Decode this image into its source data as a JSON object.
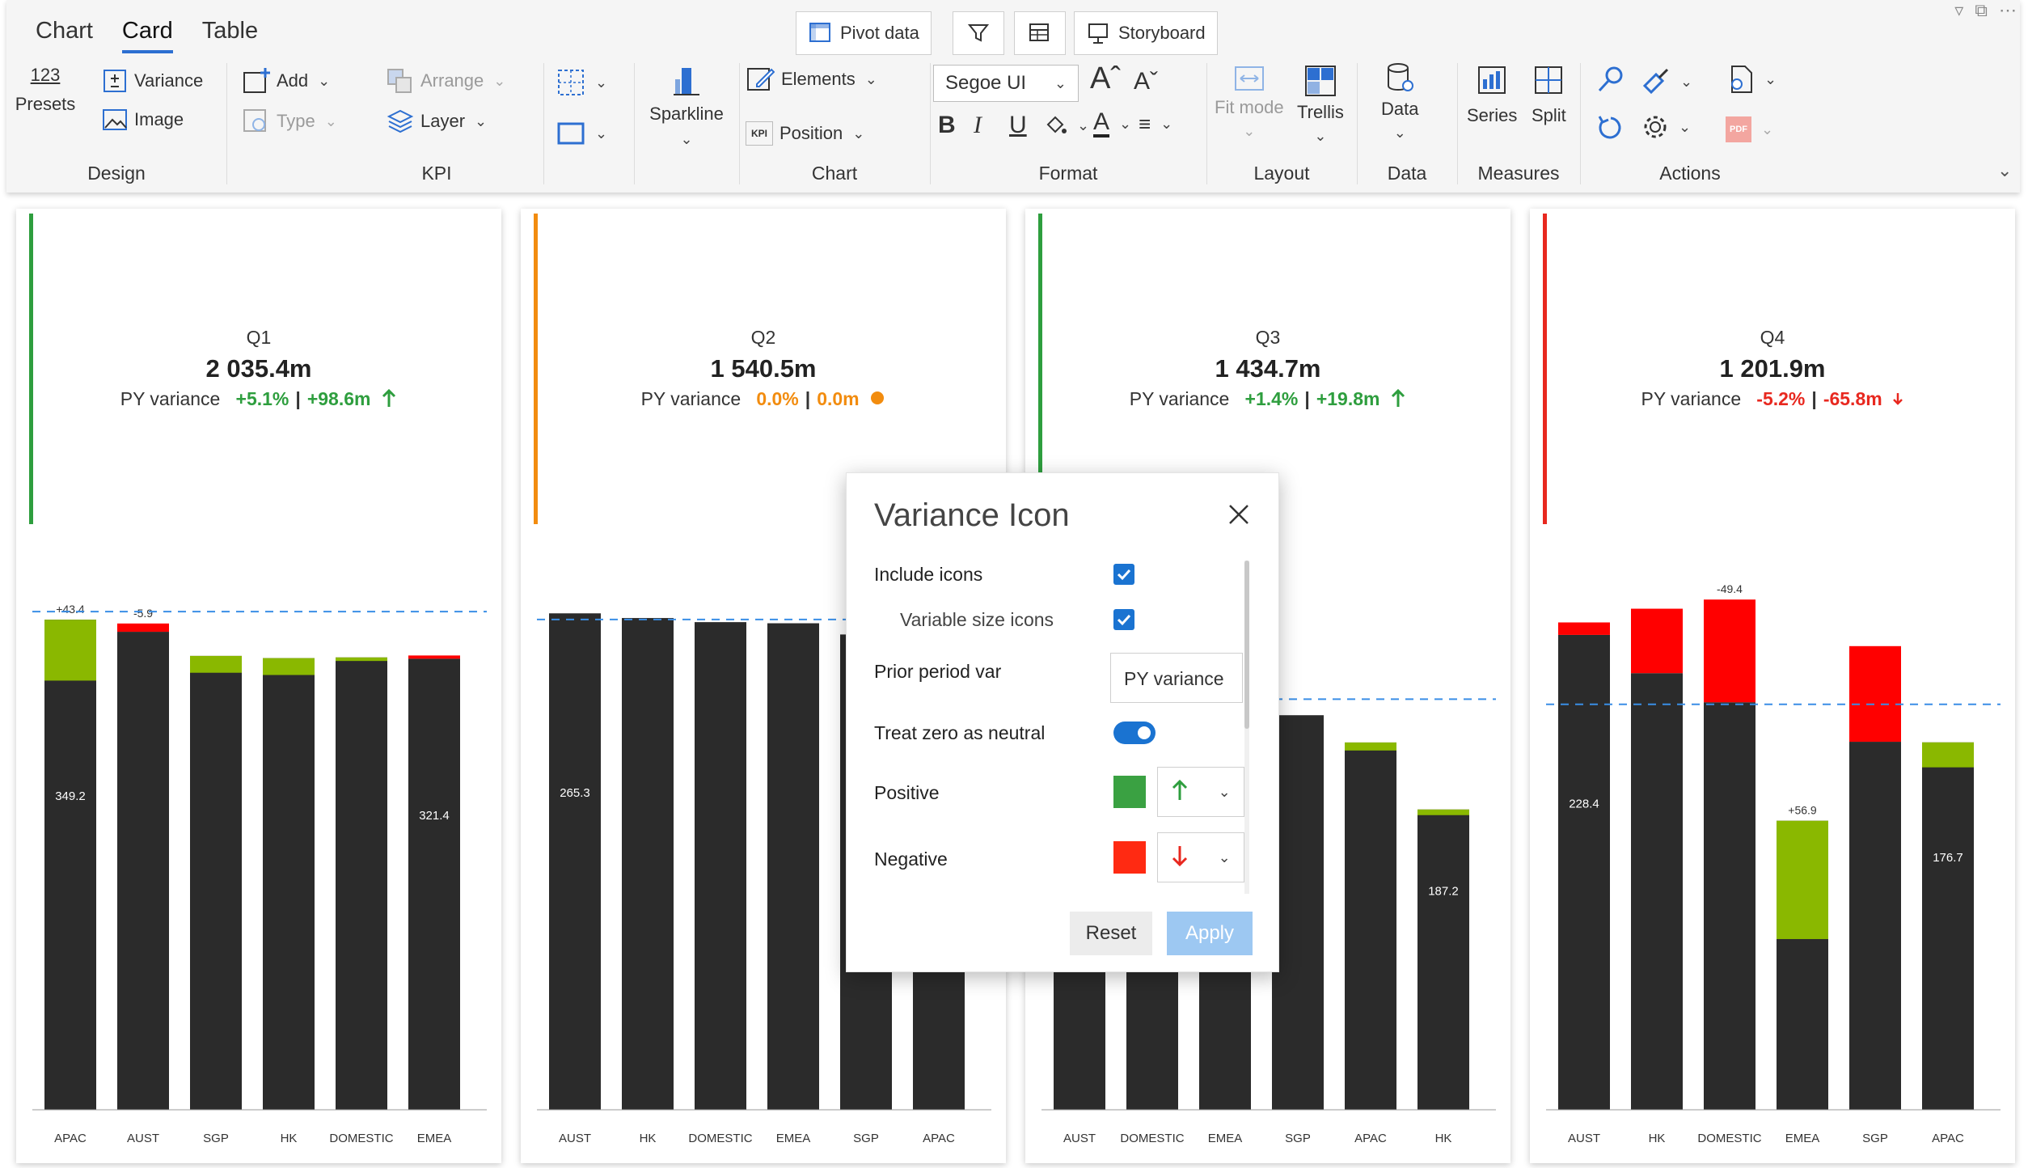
{
  "ribbon": {
    "tabs": [
      "Chart",
      "Card",
      "Table"
    ],
    "active_tab": "Card",
    "top_buttons": {
      "pivot": "Pivot data",
      "storyboard": "Storyboard"
    },
    "design": {
      "label": "Design",
      "presets_num": "123",
      "presets": "Presets",
      "variance": "Variance",
      "image": "Image"
    },
    "kpi": {
      "label": "KPI",
      "add": "Add",
      "type": "Type",
      "arrange": "Arrange",
      "layer": "Layer"
    },
    "sparkline": "Sparkline",
    "chart": {
      "label": "Chart",
      "elements": "Elements",
      "position": "Position",
      "kpi_icon": "KPI"
    },
    "format": {
      "label": "Format",
      "font": "Segoe UI",
      "bold": "B",
      "italic": "I",
      "underline": "U"
    },
    "layout": {
      "label": "Layout",
      "fit_mode": "Fit mode",
      "trellis": "Trellis"
    },
    "data": {
      "label": "Data",
      "data_btn": "Data"
    },
    "measures": {
      "label": "Measures",
      "series": "Series",
      "split": "Split"
    },
    "actions": {
      "label": "Actions",
      "pdf": "PDF"
    }
  },
  "colors": {
    "positive": "#2e9e3e",
    "neutral": "#f28c0f",
    "negative": "#e8281f",
    "bar": "#2b2b2b",
    "pos_bar": "#8ab800",
    "neg_bar": "#ff0000",
    "avg_line": "#3a8ee6"
  },
  "cards": [
    {
      "quarter": "Q1",
      "value": "2 035.4m",
      "var_label": "PY variance",
      "pct": "+5.1%",
      "sep": "|",
      "abs": "+98.6m",
      "status": "positive",
      "icon": "arrow-up-icon"
    },
    {
      "quarter": "Q2",
      "value": "1 540.5m",
      "var_label": "PY variance",
      "pct": "0.0%",
      "sep": "|",
      "abs": "0.0m",
      "status": "neutral",
      "icon": "dot-icon"
    },
    {
      "quarter": "Q3",
      "value": "1 434.7m",
      "var_label": "PY variance",
      "pct": "+1.4%",
      "sep": "|",
      "abs": "+19.8m",
      "status": "positive",
      "icon": "arrow-up-icon"
    },
    {
      "quarter": "Q4",
      "value": "1 201.9m",
      "var_label": "PY variance",
      "pct": "-5.2%",
      "sep": "|",
      "abs": "-65.8m",
      "status": "negative",
      "icon": "arrow-down-small-icon"
    }
  ],
  "chart_data": [
    {
      "type": "bar",
      "title": "Q1",
      "categories": [
        "APAC",
        "AUST",
        "SGP",
        "HK",
        "DOMESTIC",
        "EMEA"
      ],
      "values": [
        349.2,
        340.6,
        323.4,
        321.8,
        322.3,
        321.4
      ],
      "variance": [
        43.4,
        -5.9,
        12.0,
        12.0,
        2.5,
        -2.3
      ],
      "bar_labels": [
        "349.2",
        "",
        "",
        "",
        "",
        "321.4"
      ],
      "var_labels": [
        "+43.4",
        "-5.9",
        "",
        "",
        "",
        ""
      ],
      "ylim": [
        0,
        400
      ],
      "avg": 355
    },
    {
      "type": "bar",
      "title": "Q2",
      "categories": [
        "AUST",
        "HK",
        "DOMESTIC",
        "EMEA",
        "SGP",
        "APAC"
      ],
      "values": [
        265.3,
        262.8,
        260.6,
        260.0,
        254.0,
        250.0
      ],
      "variance": [
        0,
        0,
        0,
        0,
        0,
        0
      ],
      "bar_labels": [
        "265.3",
        "",
        "",
        "",
        "",
        ""
      ],
      "var_labels": [
        "",
        "",
        "",
        "",
        "",
        ""
      ],
      "ylim": [
        0,
        300
      ],
      "avg": 262
    },
    {
      "type": "bar",
      "title": "Q3",
      "categories": [
        "AUST",
        "DOMESTIC",
        "EMEA",
        "SGP",
        "APAC",
        "HK"
      ],
      "values": [
        248.0,
        248.0,
        248.0,
        246.0,
        229.0,
        187.2
      ],
      "variance": [
        0,
        0,
        0,
        0,
        5.0,
        3.5
      ],
      "bar_labels": [
        "",
        "",
        "",
        "",
        "",
        "187.2"
      ],
      "var_labels": [
        "",
        "",
        "",
        "",
        "",
        ""
      ],
      "ylim": [
        0,
        350
      ],
      "avg": 256
    },
    {
      "type": "bar",
      "title": "Q4",
      "categories": [
        "AUST",
        "HK",
        "DOMESTIC",
        "EMEA",
        "SGP",
        "APAC"
      ],
      "values": [
        228.4,
        210.0,
        196.0,
        139.0,
        177.0,
        176.7
      ],
      "variance": [
        -6.0,
        -31.0,
        -49.4,
        56.9,
        -46.0,
        12.0
      ],
      "bar_labels": [
        "228.4",
        "",
        "",
        "",
        "",
        "176.7"
      ],
      "var_labels": [
        "",
        "",
        "-49.4",
        "+56.9",
        "",
        ""
      ],
      "ylim": [
        0,
        270
      ],
      "avg": 195
    }
  ],
  "dialog": {
    "title": "Variance Icon",
    "include_icons": "Include icons",
    "variable_size": "Variable size icons",
    "prior_period": "Prior period var",
    "py_value": "PY variance",
    "treat_zero": "Treat zero as neutral",
    "positive": "Positive",
    "negative": "Negative",
    "reset": "Reset",
    "apply": "Apply"
  }
}
